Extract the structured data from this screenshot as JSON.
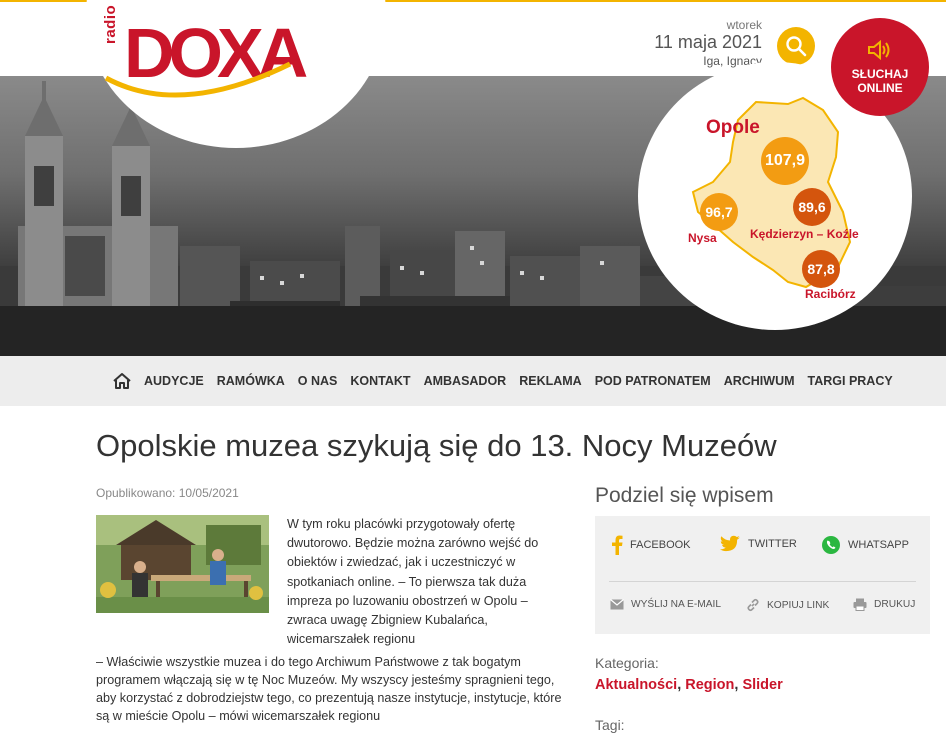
{
  "header": {
    "logo_prefix": "radio",
    "logo_name": "DOXA",
    "day_name": "wtorek",
    "date": "11 maja 2021",
    "name_day": "Iga, Ignacy",
    "listen_label_1": "SŁUCHAJ",
    "listen_label_2": "ONLINE"
  },
  "map": {
    "region": "Opole",
    "stations": [
      {
        "freq": "107,9",
        "city": ""
      },
      {
        "freq": "96,7",
        "city": "Nysa"
      },
      {
        "freq": "89,6",
        "city": "Kędzierzyn – Koźle"
      },
      {
        "freq": "87,8",
        "city": "Racibórz"
      }
    ]
  },
  "nav": {
    "items": [
      "AUDYCJE",
      "RAMÓWKA",
      "O NAS",
      "KONTAKT",
      "AMBASADOR",
      "REKLAMA",
      "POD PATRONATEM",
      "ARCHIWUM",
      "TARGI PRACY"
    ]
  },
  "article": {
    "title": "Opolskie muzea szykują się do 13. Nocy Muzeów",
    "published": "Opublikowano: 10/05/2021",
    "lead": "W tym roku placówki przygotowały ofertę dwutorowo. Będzie można zarówno wejść do obiektów i zwiedzać, jak i uczestniczyć w spotkaniach online. – To pierwsza tak duża impreza po luzowaniu obostrzeń w Opolu – zwraca uwagę Zbigniew Kubalańca, wicemarszałek regionu",
    "body": "– Właściwie wszystkie muzea i do tego Archiwum Państwowe z tak bogatym programem włączają się w tę Noc Muzeów. My wszyscy jesteśmy spragnieni tego, aby korzystać z dobrodziejstw tego, co prezentują nasze instytucje, instytucje, które są w mieście Opolu – mówi wicemarszałek regionu"
  },
  "share": {
    "title": "Podziel się wpisem",
    "facebook": "FACEBOOK",
    "twitter": "TWITTER",
    "whatsapp": "WHATSAPP",
    "email": "WYŚLIJ NA E-MAIL",
    "copy": "KOPIUJ LINK",
    "print": "DRUKUJ"
  },
  "meta": {
    "category_label": "Kategoria:",
    "categories": [
      "Aktualności",
      "Region",
      "Slider"
    ],
    "tags_label": "Tagi:"
  },
  "colors": {
    "brand_red": "#c9152a",
    "accent_yellow": "#f3b400",
    "freq_orange": "#f39c12",
    "freq_dark_orange": "#d4550d"
  }
}
